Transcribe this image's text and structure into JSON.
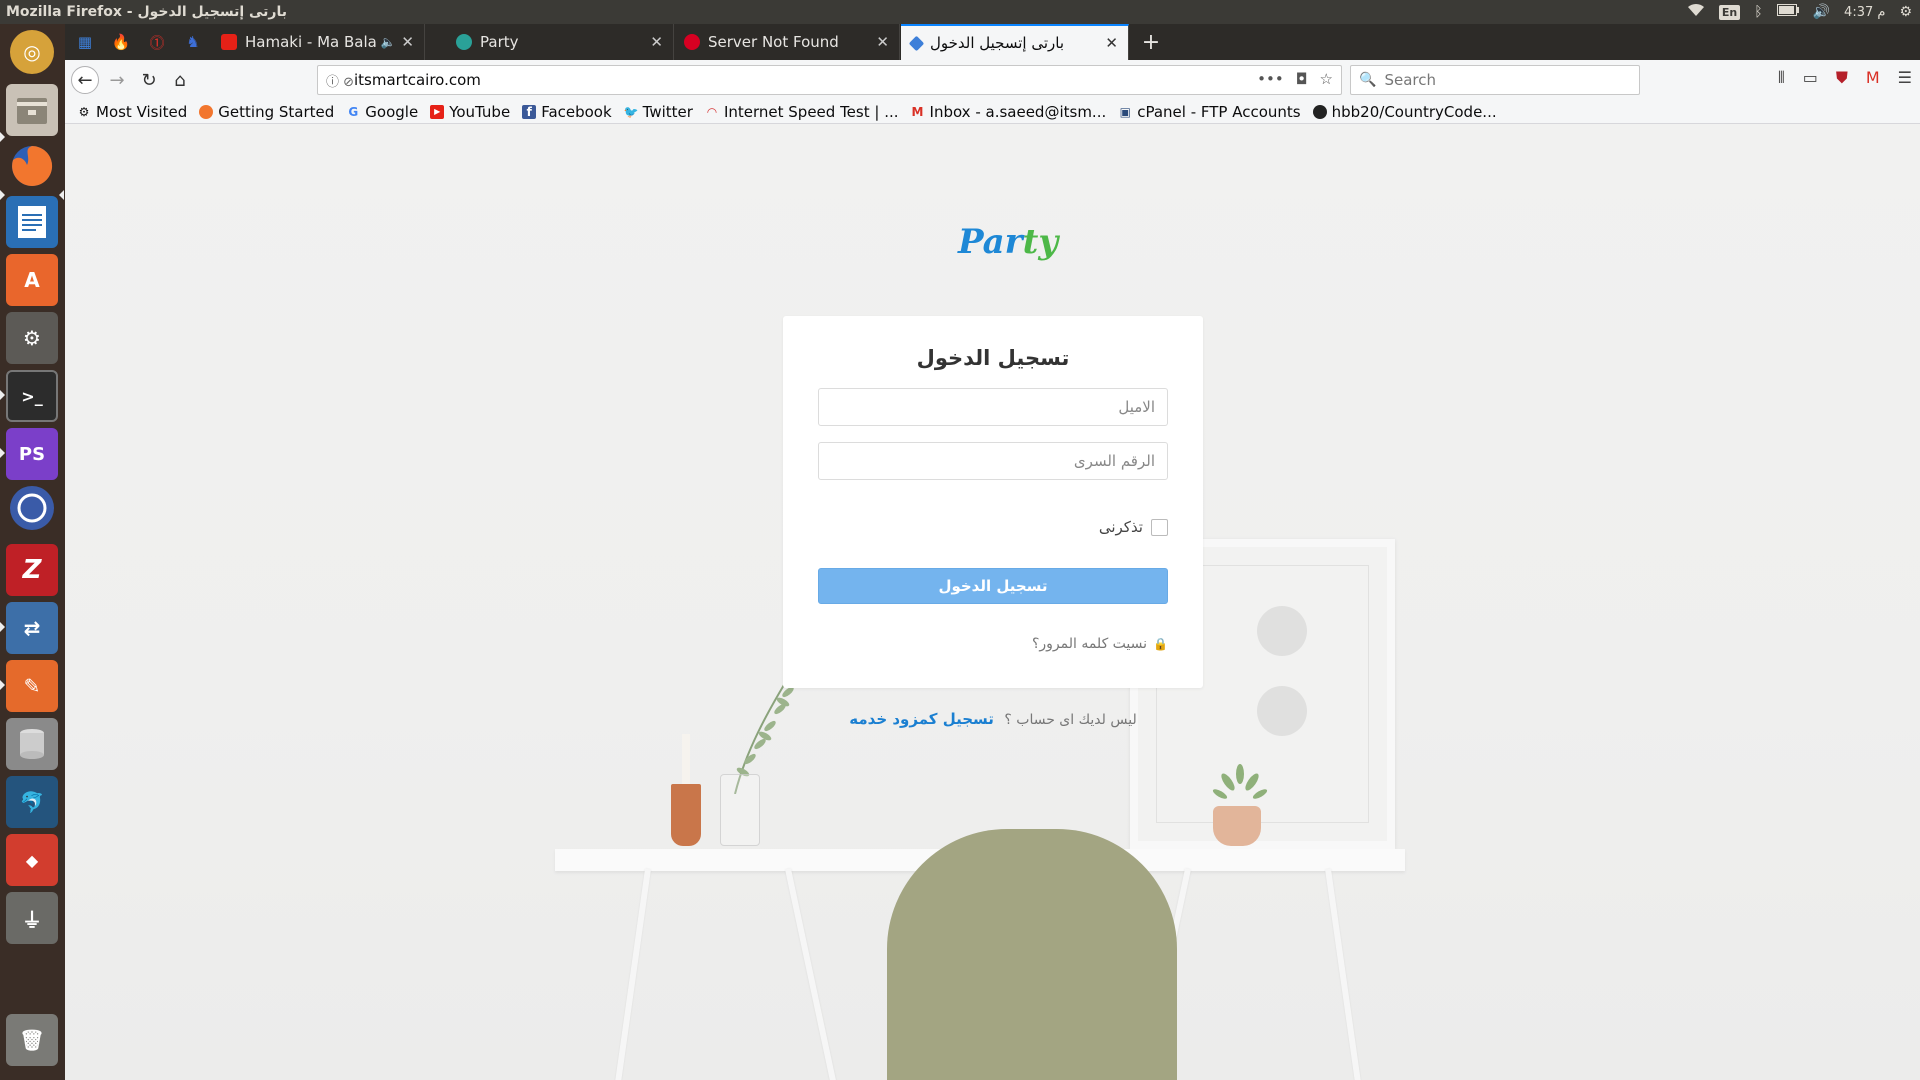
{
  "window": {
    "title": "Mozilla Firefox - بارتى إتسجيل الدخول"
  },
  "tray": {
    "lang": "En",
    "time": "4:37 م"
  },
  "tabs": [
    {
      "title": "Hamaki - Ma Balash C",
      "icon_color": "#e62117"
    },
    {
      "title": "Party",
      "icon_color": "#2aa198"
    },
    {
      "title": "Server Not Found",
      "icon_color": "#d70022"
    },
    {
      "title": "بارتى إتسجيل الدخول",
      "icon_color": "#3d7fd9"
    }
  ],
  "urlbar": {
    "url": "itsmartcairo.com"
  },
  "search": {
    "placeholder": "Search"
  },
  "bookmarks": [
    {
      "label": "Most Visited",
      "icon": "gear-icon"
    },
    {
      "label": "Getting Started",
      "icon": "firefox-icon"
    },
    {
      "label": "Google",
      "icon": "google-icon"
    },
    {
      "label": "YouTube",
      "icon": "youtube-icon"
    },
    {
      "label": "Facebook",
      "icon": "facebook-icon"
    },
    {
      "label": "Twitter",
      "icon": "twitter-icon"
    },
    {
      "label": "Internet Speed Test | ...",
      "icon": "speedtest-icon"
    },
    {
      "label": "Inbox - a.saeed@itsm...",
      "icon": "gmail-icon"
    },
    {
      "label": "cPanel - FTP Accounts",
      "icon": "cpanel-icon"
    },
    {
      "label": "hbb20/CountryCode...",
      "icon": "github-icon"
    }
  ],
  "page": {
    "logo_a": "Par",
    "logo_b": "ty",
    "login_title": "تسجيل الدخول",
    "email_placeholder": "الاميل",
    "password_placeholder": "الرقم السرى",
    "remember_label": "تذكرنى",
    "login_button": "تسجيل الدخول",
    "forgot_label": "نسيت كلمه المرور؟",
    "no_account_text": "ليس لديك اى حساب ؟",
    "signup_link": "تسجيل كمزود خدمه"
  },
  "colors": {
    "brand_blue": "#1e88d6",
    "brand_green": "#4db848",
    "button": "#74b4ee",
    "link": "#1a7fd1"
  }
}
